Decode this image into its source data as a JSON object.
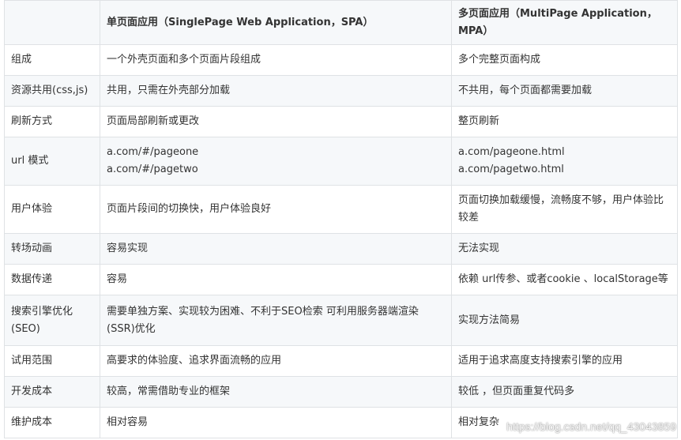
{
  "table": {
    "headers": [
      "",
      "单页面应用（SinglePage Web Application，SPA）",
      "多页面应用（MultiPage Application，MPA）"
    ],
    "rows": [
      {
        "label": "组成",
        "spa": [
          "一个外壳页面和多个页面片段组成"
        ],
        "mpa": [
          "多个完整页面构成"
        ]
      },
      {
        "label": "资源共用(css,js)",
        "spa": [
          "共用，只需在外壳部分加载"
        ],
        "mpa": [
          "不共用，每个页面都需要加载"
        ]
      },
      {
        "label": "刷新方式",
        "spa": [
          "页面局部刷新或更改"
        ],
        "mpa": [
          "整页刷新"
        ]
      },
      {
        "label": "url 模式",
        "spa": [
          "a.com/#/pageone",
          "a.com/#/pagetwo"
        ],
        "mpa": [
          "a.com/pageone.html",
          "a.com/pagetwo.html"
        ]
      },
      {
        "label": "用户体验",
        "spa": [
          "页面片段间的切换快，用户体验良好"
        ],
        "mpa": [
          "页面切换加载缓慢，流畅度不够，用户体验比较差"
        ]
      },
      {
        "label": "转场动画",
        "spa": [
          "容易实现"
        ],
        "mpa": [
          "无法实现"
        ]
      },
      {
        "label": "数据传递",
        "spa": [
          "容易"
        ],
        "mpa": [
          "依赖 url传参、或者cookie 、localStorage等"
        ]
      },
      {
        "label": "搜索引擎优化(SEO)",
        "spa": [
          "需要单独方案、实现较为困难、不利于SEO检索 可利用服务器端渲染(SSR)优化"
        ],
        "mpa": [
          "实现方法简易"
        ]
      },
      {
        "label": "试用范围",
        "spa": [
          "高要求的体验度、追求界面流畅的应用"
        ],
        "mpa": [
          "适用于追求高度支持搜索引擎的应用"
        ]
      },
      {
        "label": "开发成本",
        "spa": [
          "较高，常需借助专业的框架"
        ],
        "mpa": [
          "较低 ，但页面重复代码多"
        ]
      },
      {
        "label": "维护成本",
        "spa": [
          "相对容易"
        ],
        "mpa": [
          "相对复杂"
        ]
      }
    ]
  },
  "watermark": "https://blog.csdn.net/qq_43043859"
}
